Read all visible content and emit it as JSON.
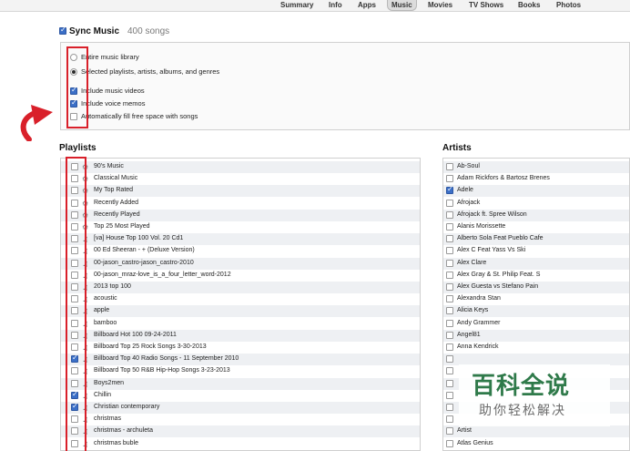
{
  "tabs": [
    {
      "label": "Summary",
      "active": false
    },
    {
      "label": "Info",
      "active": false
    },
    {
      "label": "Apps",
      "active": false
    },
    {
      "label": "Music",
      "active": true
    },
    {
      "label": "Movies",
      "active": false
    },
    {
      "label": "TV Shows",
      "active": false
    },
    {
      "label": "Books",
      "active": false
    },
    {
      "label": "Photos",
      "active": false
    }
  ],
  "sync": {
    "title": "Sync Music",
    "count": "400 songs",
    "checked": true
  },
  "options": {
    "entire_library": "Entire music library",
    "selected": "Selected playlists, artists, albums, and genres",
    "include_videos": "Include music videos",
    "include_memos": "Include voice memos",
    "autofill": "Automatically fill free space with songs"
  },
  "playlists": {
    "title": "Playlists",
    "items": [
      {
        "label": "90's Music",
        "icon": "gear-icon",
        "checked": false
      },
      {
        "label": "Classical Music",
        "icon": "gear-icon",
        "checked": false
      },
      {
        "label": "My Top Rated",
        "icon": "gear-icon",
        "checked": false
      },
      {
        "label": "Recently Added",
        "icon": "gear-icon",
        "checked": false
      },
      {
        "label": "Recently Played",
        "icon": "gear-icon",
        "checked": false
      },
      {
        "label": "Top 25 Most Played",
        "icon": "gear-icon",
        "checked": false
      },
      {
        "label": "[va] House Top 100 Vol. 20 Cd1",
        "icon": "playlist-icon",
        "checked": false
      },
      {
        "label": "00 Ed Sheeran - + (Deluxe Version)",
        "icon": "playlist-icon",
        "checked": false
      },
      {
        "label": "00-jason_castro-jason_castro-2010",
        "icon": "playlist-icon",
        "checked": false
      },
      {
        "label": "00-jason_mraz-love_is_a_four_letter_word-2012",
        "icon": "playlist-icon",
        "checked": false
      },
      {
        "label": "2013 top 100",
        "icon": "playlist-icon",
        "checked": false
      },
      {
        "label": "acoustic",
        "icon": "playlist-icon",
        "checked": false
      },
      {
        "label": "apple",
        "icon": "playlist-icon",
        "checked": false
      },
      {
        "label": "bamboo",
        "icon": "playlist-icon",
        "checked": false
      },
      {
        "label": "Billboard Hot 100 09-24-2011",
        "icon": "playlist-icon",
        "checked": false
      },
      {
        "label": "Billboard Top 25 Rock Songs 3-30-2013",
        "icon": "playlist-icon",
        "checked": false
      },
      {
        "label": "Billboard Top 40 Radio Songs - 11 September 2010",
        "icon": "playlist-icon",
        "checked": true
      },
      {
        "label": "Billboard Top 50 R&B Hip-Hop Songs 3-23-2013",
        "icon": "playlist-icon",
        "checked": false
      },
      {
        "label": "Boys2men",
        "icon": "playlist-icon",
        "checked": false
      },
      {
        "label": "Chillin",
        "icon": "playlist-icon",
        "checked": true
      },
      {
        "label": "Christian contemporary",
        "icon": "playlist-icon",
        "checked": true
      },
      {
        "label": "christmas",
        "icon": "playlist-icon",
        "checked": false
      },
      {
        "label": "christmas - archuleta",
        "icon": "playlist-icon",
        "checked": false
      },
      {
        "label": "christmas buble",
        "icon": "playlist-icon",
        "checked": false
      }
    ]
  },
  "artists": {
    "title": "Artists",
    "items": [
      {
        "label": "Ab-Soul",
        "checked": false
      },
      {
        "label": "Adam Rickfors & Bartosz Brenes",
        "checked": false
      },
      {
        "label": "Adele",
        "checked": true
      },
      {
        "label": "Afrojack",
        "checked": false
      },
      {
        "label": "Afrojack ft. Spree Wilson",
        "checked": false
      },
      {
        "label": "Alanis Morissette",
        "checked": false
      },
      {
        "label": "Alberto Sola Feat Pueblo Cafe",
        "checked": false
      },
      {
        "label": "Alex C Feat Yass Vs Ski",
        "checked": false
      },
      {
        "label": "Alex Clare",
        "checked": false
      },
      {
        "label": "Alex Gray & St. Philip Feat. S",
        "checked": false
      },
      {
        "label": "Alex Guesta vs Stefano Pain",
        "checked": false
      },
      {
        "label": "Alexandra Stan",
        "checked": false
      },
      {
        "label": "Alicia Keys",
        "checked": false
      },
      {
        "label": "Andy Grammer",
        "checked": false
      },
      {
        "label": "Angel81",
        "checked": false
      },
      {
        "label": "Anna Kendrick",
        "checked": false
      },
      {
        "label": "",
        "checked": false
      },
      {
        "label": "",
        "checked": false
      },
      {
        "label": "",
        "checked": false
      },
      {
        "label": "",
        "checked": false
      },
      {
        "label": "",
        "checked": false
      },
      {
        "label": "",
        "checked": false
      },
      {
        "label": "Artist",
        "checked": false
      },
      {
        "label": "Atlas Genius",
        "checked": false
      }
    ]
  },
  "watermark": {
    "main": "百科全说",
    "sub": "助你轻松解决"
  }
}
